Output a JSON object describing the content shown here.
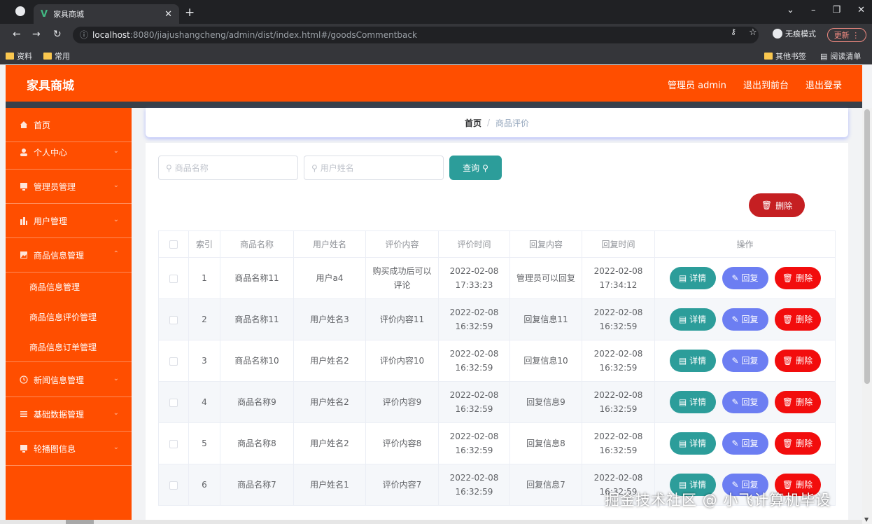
{
  "browser": {
    "tab_title": "家具商城",
    "tab_favicon": "vue-icon",
    "url_host": "localhost",
    "url_rest": ":8080/jiajushangcheng/admin/dist/index.html#/goodsCommentback",
    "incognito_label": "无痕模式",
    "update_label": "更新",
    "bookmarks": [
      "资料",
      "常用"
    ],
    "other_bookmarks": "其他书签",
    "reading_list": "阅读清单"
  },
  "header": {
    "brand": "家具商城",
    "admin_label": "管理员 admin",
    "to_front": "退出到前台",
    "logout": "退出登录"
  },
  "sidebar": {
    "items": [
      {
        "label": "首页",
        "icon": "home-icon"
      },
      {
        "label": "个人中心",
        "icon": "user-icon"
      },
      {
        "label": "管理员管理",
        "icon": "monitor-icon"
      },
      {
        "label": "用户管理",
        "icon": "chart-icon"
      },
      {
        "label": "商品信息管理",
        "icon": "picture-icon"
      },
      {
        "label": "新闻信息管理",
        "icon": "clock-icon"
      },
      {
        "label": "基础数据管理",
        "icon": "menu-icon"
      },
      {
        "label": "轮播图信息",
        "icon": "monitor-icon"
      }
    ],
    "subitems": [
      "商品信息管理",
      "商品信息评价管理",
      "商品信息订单管理"
    ]
  },
  "breadcrumb": {
    "home": "首页",
    "sep": "/",
    "current": "商品评价"
  },
  "search": {
    "goods_placeholder": "商品名称",
    "user_placeholder": "用户姓名",
    "button": "查询"
  },
  "bulk_delete": "删除",
  "table": {
    "headers": [
      "索引",
      "商品名称",
      "用户姓名",
      "评价内容",
      "评价时间",
      "回复内容",
      "回复时间",
      "操作"
    ],
    "rows": [
      {
        "index": "1",
        "goods": "商品名称11",
        "user": "用户a4",
        "content": "购买成功后可以评论",
        "time": "2022-02-08 17:33:23",
        "reply": "管理员可以回复",
        "reply_time": "2022-02-08 17:34:12"
      },
      {
        "index": "2",
        "goods": "商品名称11",
        "user": "用户姓名3",
        "content": "评价内容11",
        "time": "2022-02-08 16:32:59",
        "reply": "回复信息11",
        "reply_time": "2022-02-08 16:32:59"
      },
      {
        "index": "3",
        "goods": "商品名称10",
        "user": "用户姓名2",
        "content": "评价内容10",
        "time": "2022-02-08 16:32:59",
        "reply": "回复信息10",
        "reply_time": "2022-02-08 16:32:59"
      },
      {
        "index": "4",
        "goods": "商品名称9",
        "user": "用户姓名2",
        "content": "评价内容9",
        "time": "2022-02-08 16:32:59",
        "reply": "回复信息9",
        "reply_time": "2022-02-08 16:32:59"
      },
      {
        "index": "5",
        "goods": "商品名称8",
        "user": "用户姓名2",
        "content": "评价内容8",
        "time": "2022-02-08 16:32:59",
        "reply": "回复信息8",
        "reply_time": "2022-02-08 16:32:59"
      },
      {
        "index": "6",
        "goods": "商品名称7",
        "user": "用户姓名1",
        "content": "评价内容7",
        "time": "2022-02-08 16:32:59",
        "reply": "回复信息7",
        "reply_time": "2022-02-08 16:32:59"
      }
    ],
    "actions": {
      "detail": "详情",
      "reply": "回复",
      "delete": "删除"
    }
  },
  "watermark": "掘金技术社区 @ 小飞计算机毕设",
  "colors": {
    "brand_orange": "#ff4e00",
    "teal": "#2c9d9a",
    "reply_blue": "#6c7ef2",
    "delete_red": "#f20d0d",
    "bulk_delete_red": "#c51f22"
  }
}
